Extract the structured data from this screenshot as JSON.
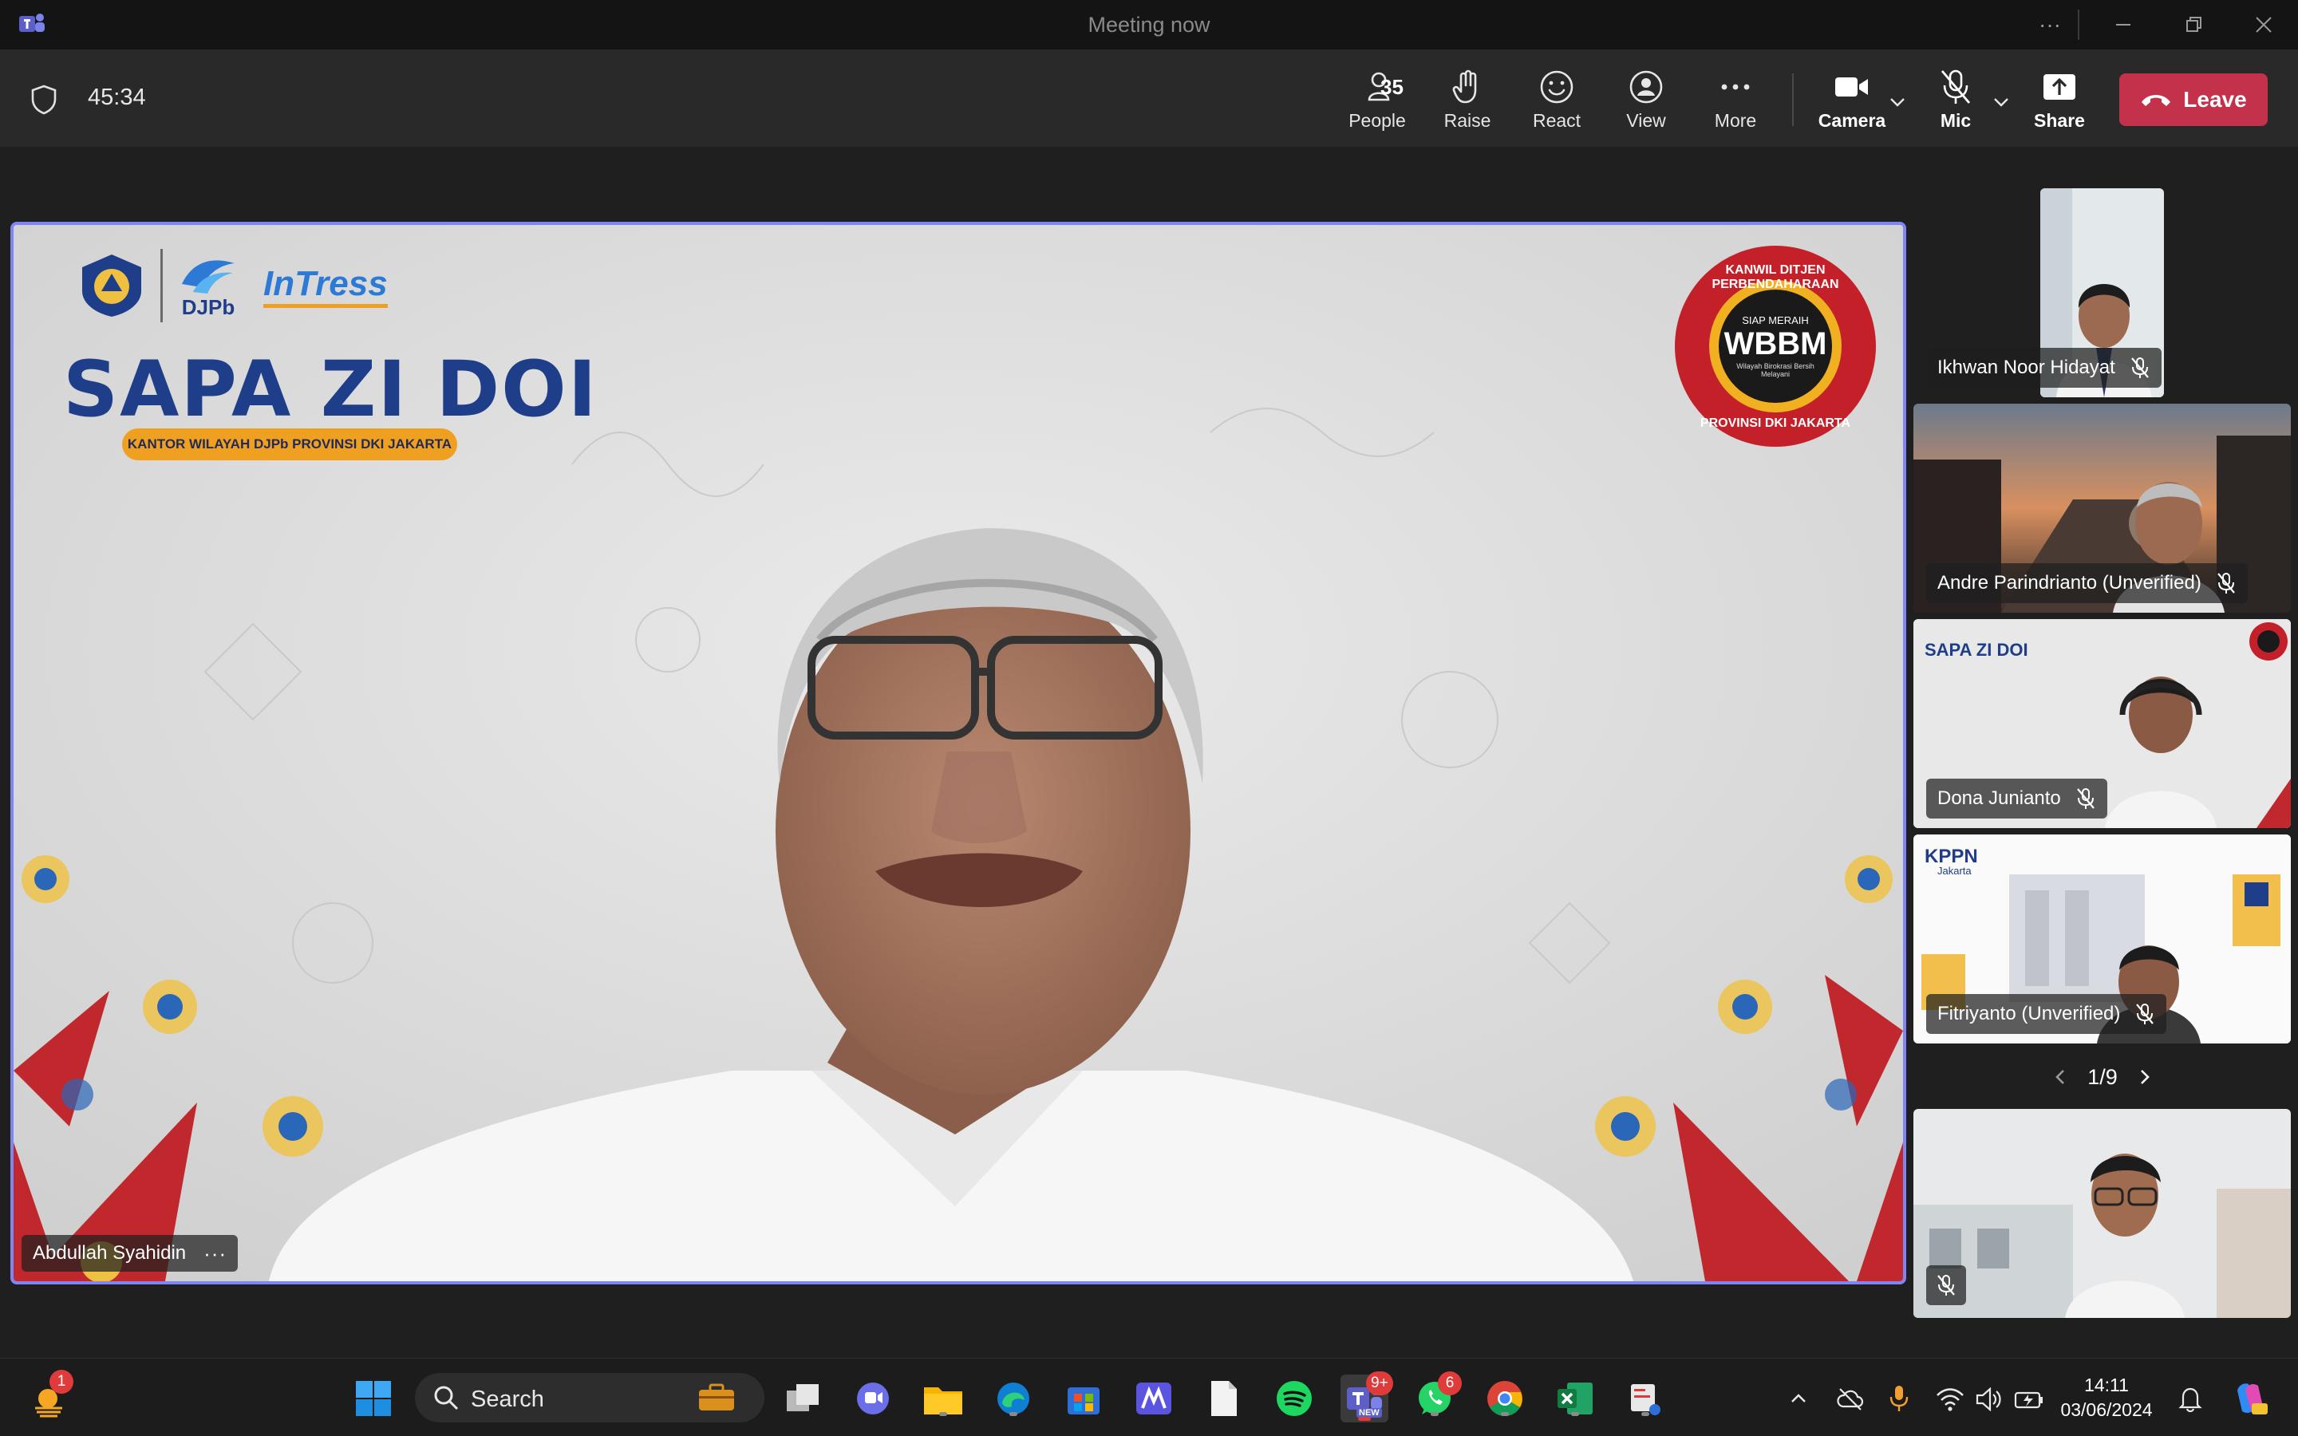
{
  "window": {
    "title": "Meeting now"
  },
  "meeting": {
    "timer": "45:34",
    "toolbar": {
      "people_count": "35",
      "people_label": "People",
      "raise_label": "Raise",
      "react_label": "React",
      "view_label": "View",
      "more_label": "More",
      "camera_label": "Camera",
      "mic_label": "Mic",
      "share_label": "Share",
      "leave_label": "Leave"
    },
    "main_speaker": {
      "name": "Abdullah Syahidin",
      "background_text": {
        "title": "SAPA ZI DOI",
        "subtitle": "KANTOR WILAYAH DJPb PROVINSI DKI JAKARTA",
        "logo_djpb": "DJPb",
        "logo_intress": "InTress",
        "seal_top": "KANWIL DITJEN PERBENDAHARAAN",
        "seal_small": "SIAP MERAIH",
        "seal_main": "WBBM",
        "seal_sub": "Wilayah Birokrasi Bersih Melayani",
        "seal_bottom": "PROVINSI DKI JAKARTA"
      }
    },
    "participants": [
      {
        "name": "Ikhwan Noor Hidayat"
      },
      {
        "name": "Andre Parindrianto (Unverified)"
      },
      {
        "name": "Dona Junianto",
        "bg_text": "SAPA ZI DOI"
      },
      {
        "name": "Fitriyanto (Unverified)",
        "bg_text": "KPPN",
        "bg_sub": "Jakarta"
      }
    ],
    "pager": "1/9"
  },
  "taskbar": {
    "search_placeholder": "Search",
    "weather_badge": "1",
    "teams_badge": "9+",
    "teams_tag": "NEW",
    "whatsapp_badge": "6",
    "time": "14:11",
    "date": "03/06/2024"
  },
  "colors": {
    "accent": "#7f85f5",
    "leave": "#c4314b",
    "titlebar": "#141414",
    "stage": "#1f1f1f"
  }
}
